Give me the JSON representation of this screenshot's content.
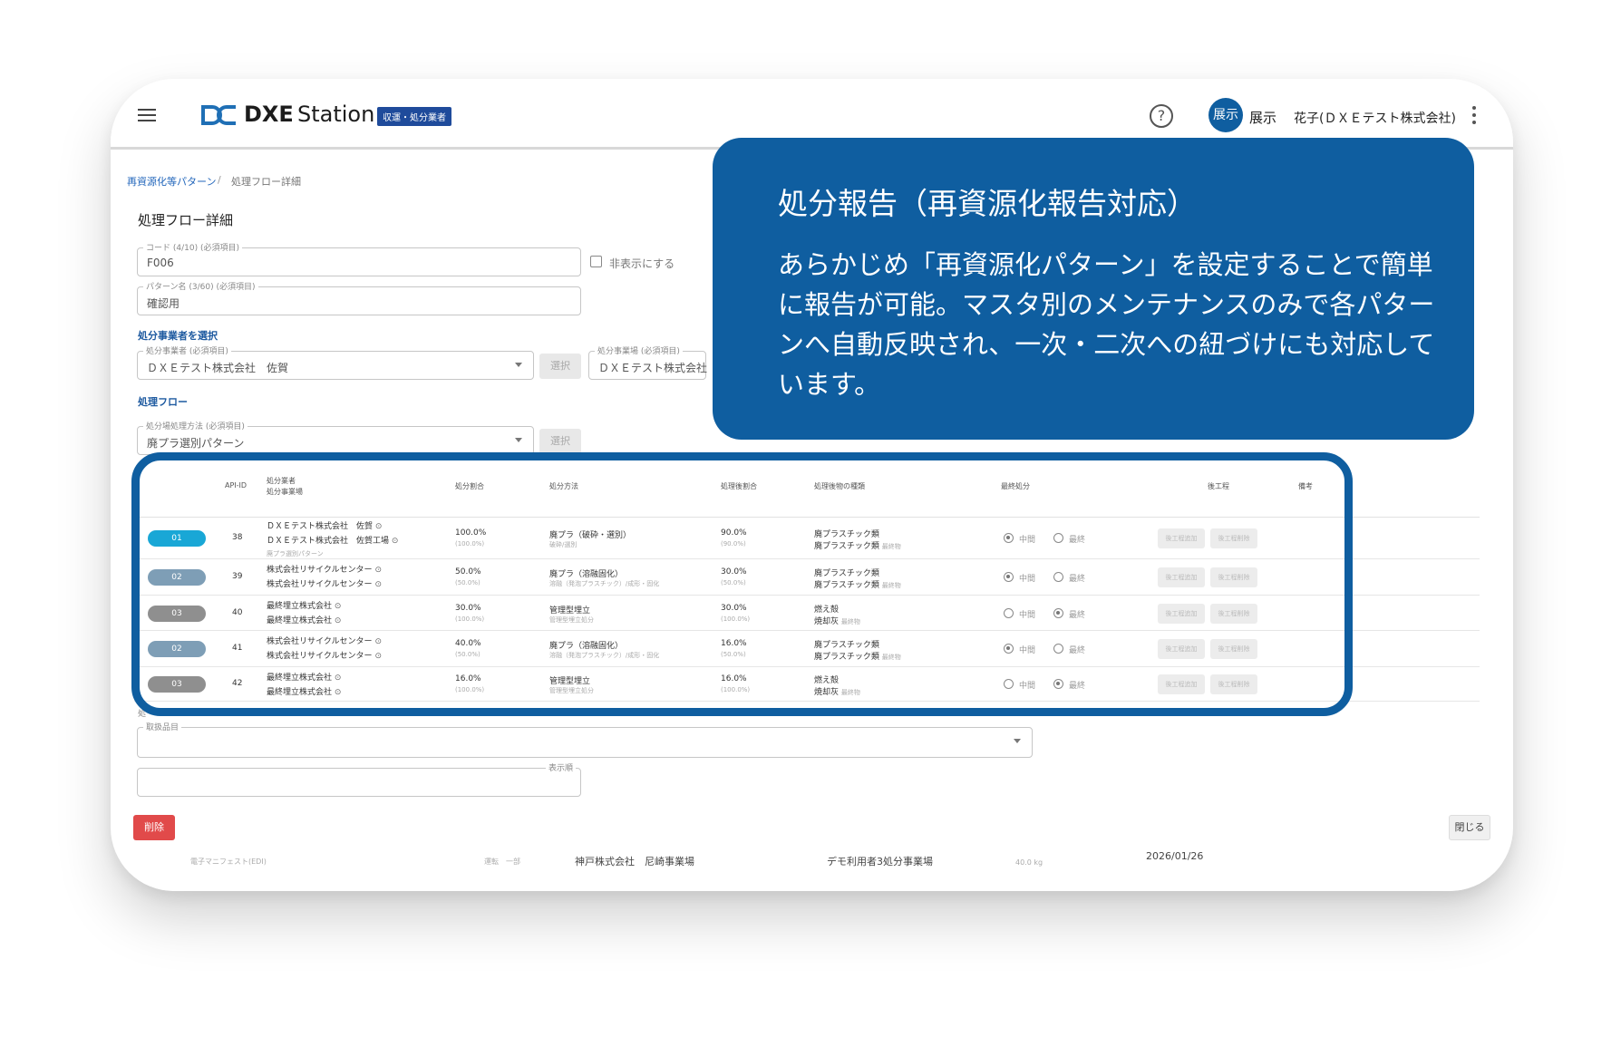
{
  "app": {
    "logo_dxe": "DXE",
    "logo_station": "Station",
    "role_badge": "収運・処分業者",
    "avatar_text": "展示",
    "user_name_1": "展示",
    "user_name_2": "花子(ＤＸＥテスト株式会社)"
  },
  "breadcrumb": {
    "parent": "再資源化等パターン",
    "separator": "/",
    "current": "処理フロー詳細"
  },
  "dialog": {
    "title": "処理フロー詳細",
    "code_label": "コード (4/10) (必須項目)",
    "code_value": "F006",
    "hide_label": "非表示にする",
    "pattern_label": "パターン名 (3/60) (必須項目)",
    "pattern_value": "確認用",
    "select_operator_section": "処分事業者を選択",
    "operator_label": "処分事業者 (必須項目)",
    "operator_value": "ＤＸＥテスト株式会社　佐賀",
    "select_button": "選択",
    "site_label": "処分事業場 (必須項目)",
    "site_value": "ＤＸＥテスト株式会社",
    "flow_section": "処理フロー",
    "method_label": "処分場処理方法 (必須項目)",
    "method_value": "廃プラ選別パターン",
    "method_select_button": "選択",
    "items_label": "取扱品目",
    "display_label": "表示順",
    "delete_button": "削除",
    "close_button": "閉じる",
    "lower_section_fragment": "処"
  },
  "table": {
    "headers": {
      "api_id": "API-ID",
      "operator": "処分業者",
      "operator_site": "処分事業場",
      "ratio": "処分割合",
      "method": "処分方法",
      "after_ratio": "処理後割合",
      "waste_type": "処理後物の種類",
      "final": "最終処分",
      "post_process": "後工程",
      "note": "備考"
    },
    "radio_mid": "中間",
    "radio_final": "最終",
    "btn_add": "後工程追加",
    "btn_delete": "後工程削除",
    "rows": [
      {
        "badge": "01",
        "badge_color": "#19a7d6",
        "api": "38",
        "op1": "ＤＸＥテスト株式会社　佐賀",
        "op2": "ＤＸＥテスト株式会社　佐賀工場",
        "extra": "廃プラ選別パターン",
        "ratio": "100.0%",
        "ratio_sub": "(100.0%)",
        "method": "廃プラ（破砕・選別）",
        "method_sub": "破砕/選別",
        "after": "90.0%",
        "after_sub": "(90.0%)",
        "w1": "廃プラスチック類",
        "w2": "廃プラスチック類",
        "w2_sub": "最終物",
        "final": "mid"
      },
      {
        "badge": "02",
        "badge_color": "#7e9eb6",
        "api": "39",
        "op1": "株式会社リサイクルセンター",
        "op2": "株式会社リサイクルセンター",
        "extra": "",
        "ratio": "50.0%",
        "ratio_sub": "(50.0%)",
        "method": "廃プラ（溶融固化）",
        "method_sub": "溶融（発泡プラスチック）/成形・固化",
        "after": "30.0%",
        "after_sub": "(50.0%)",
        "w1": "廃プラスチック類",
        "w2": "廃プラスチック類",
        "w2_sub": "最終物",
        "final": "mid"
      },
      {
        "badge": "03",
        "badge_color": "#8f8f8f",
        "api": "40",
        "op1": "最終埋立株式会社",
        "op2": "最終埋立株式会社",
        "extra": "",
        "ratio": "30.0%",
        "ratio_sub": "(100.0%)",
        "method": "管理型埋立",
        "method_sub": "管理型埋立処分",
        "after": "30.0%",
        "after_sub": "(100.0%)",
        "w1": "燃え殻",
        "w2": "焼却灰",
        "w2_sub": "最終物",
        "final": "final"
      },
      {
        "badge": "02",
        "badge_color": "#7e9eb6",
        "api": "41",
        "op1": "株式会社リサイクルセンター",
        "op2": "株式会社リサイクルセンター",
        "extra": "",
        "ratio": "40.0%",
        "ratio_sub": "(50.0%)",
        "method": "廃プラ（溶融固化）",
        "method_sub": "溶融（発泡プラスチック）/成形・固化",
        "after": "16.0%",
        "after_sub": "(50.0%)",
        "w1": "廃プラスチック類",
        "w2": "廃プラスチック類",
        "w2_sub": "最終物",
        "final": "mid"
      },
      {
        "badge": "03",
        "badge_color": "#8f8f8f",
        "api": "42",
        "op1": "最終埋立株式会社",
        "op2": "最終埋立株式会社",
        "extra": "",
        "ratio": "16.0%",
        "ratio_sub": "(100.0%)",
        "method": "管理型埋立",
        "method_sub": "管理型埋立処分",
        "after": "16.0%",
        "after_sub": "(100.0%)",
        "w1": "燃え殻",
        "w2": "焼却灰",
        "w2_sub": "最終物",
        "final": "final"
      }
    ]
  },
  "background_row": {
    "manifest_type": "電子マニフェスト(EDI)",
    "transport": "運転　一部",
    "company": "神戸株式会社　尼崎事業場",
    "facility": "デモ利用者3処分事業場",
    "weight": "40.0 kg",
    "date": "2026/01/26"
  },
  "callout": {
    "title": "処分報告（再資源化報告対応）",
    "body": "あらかじめ「再資源化パターン」を設定することで簡単に報告が可能。マスタ別のメンテナンスのみで各パターンへ自動反映され、一次・二次への紐づけにも対応しています。"
  },
  "colors": {
    "brand_blue": "#0f5ea0",
    "link_blue": "#2266bb",
    "delete_red": "#e14a4a"
  }
}
